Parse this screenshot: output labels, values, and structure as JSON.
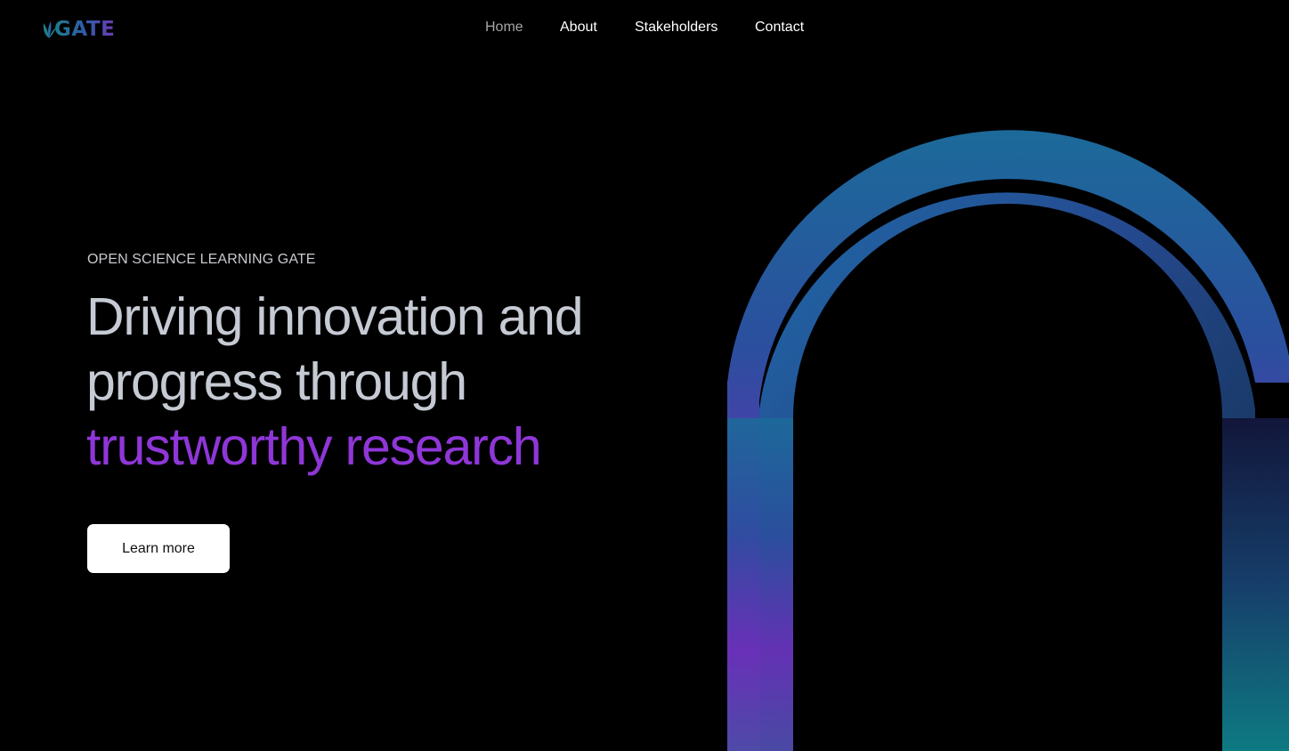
{
  "brand": {
    "logo_text": "GATE",
    "logo_icon": "leaf-sprout-icon",
    "colors": {
      "teal": "#1f7d8c",
      "blue": "#2b5fa6",
      "purple": "#6a3bb8"
    }
  },
  "nav": {
    "items": [
      {
        "label": "Home",
        "active": true
      },
      {
        "label": "About",
        "active": false
      },
      {
        "label": "Stakeholders",
        "active": false
      },
      {
        "label": "Contact",
        "active": false
      }
    ]
  },
  "hero": {
    "eyebrow": "OPEN SCIENCE LEARNING GATE",
    "headline_line1": "Driving innovation and",
    "headline_line2": "progress through",
    "headline_accent": "trustworthy research",
    "cta_label": "Learn more"
  },
  "colors": {
    "background": "#000000",
    "headline": "#c5cad3",
    "accent": "#8f36d8",
    "nav_active": "#a6a6a6",
    "button_bg": "#ffffff"
  }
}
